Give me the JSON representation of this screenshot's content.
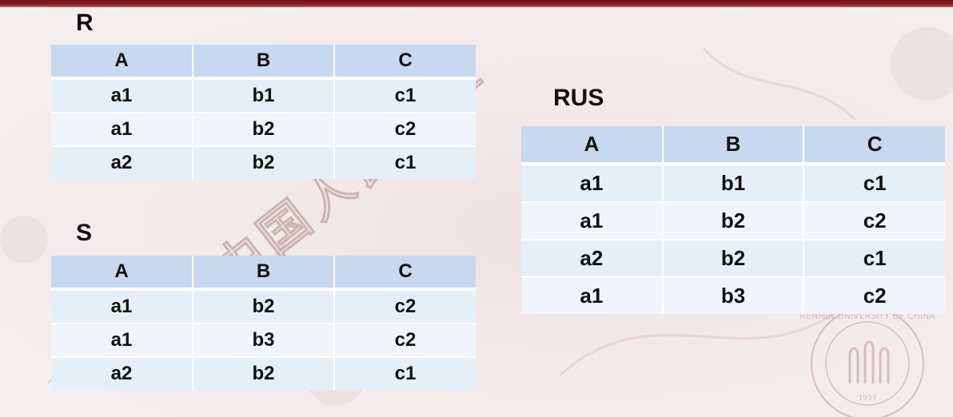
{
  "relations": [
    {
      "name": "R",
      "columns": [
        "A",
        "B",
        "C"
      ],
      "rows": [
        [
          "a1",
          "b1",
          "c1"
        ],
        [
          "a1",
          "b2",
          "c2"
        ],
        [
          "a2",
          "b2",
          "c1"
        ]
      ]
    },
    {
      "name": "S",
      "columns": [
        "A",
        "B",
        "C"
      ],
      "rows": [
        [
          "a1",
          "b2",
          "c2"
        ],
        [
          "a1",
          "b3",
          "c2"
        ],
        [
          "a2",
          "b2",
          "c1"
        ]
      ]
    },
    {
      "name": "RUS",
      "columns": [
        "A",
        "B",
        "C"
      ],
      "rows": [
        [
          "a1",
          "b1",
          "c1"
        ],
        [
          "a1",
          "b2",
          "c2"
        ],
        [
          "a2",
          "b2",
          "c1"
        ],
        [
          "a1",
          "b3",
          "c2"
        ]
      ]
    }
  ],
  "watermark": {
    "text": "中国人民大学",
    "seal_text": "RENMIN UNIVERSITY OF CHINA",
    "seal_year": "1937"
  },
  "colors": {
    "header_fill": "#c8d8ee",
    "row_fill_odd": "#e6eef8",
    "row_fill_even": "#f1f5fb",
    "top_bar": "#7a1414"
  }
}
